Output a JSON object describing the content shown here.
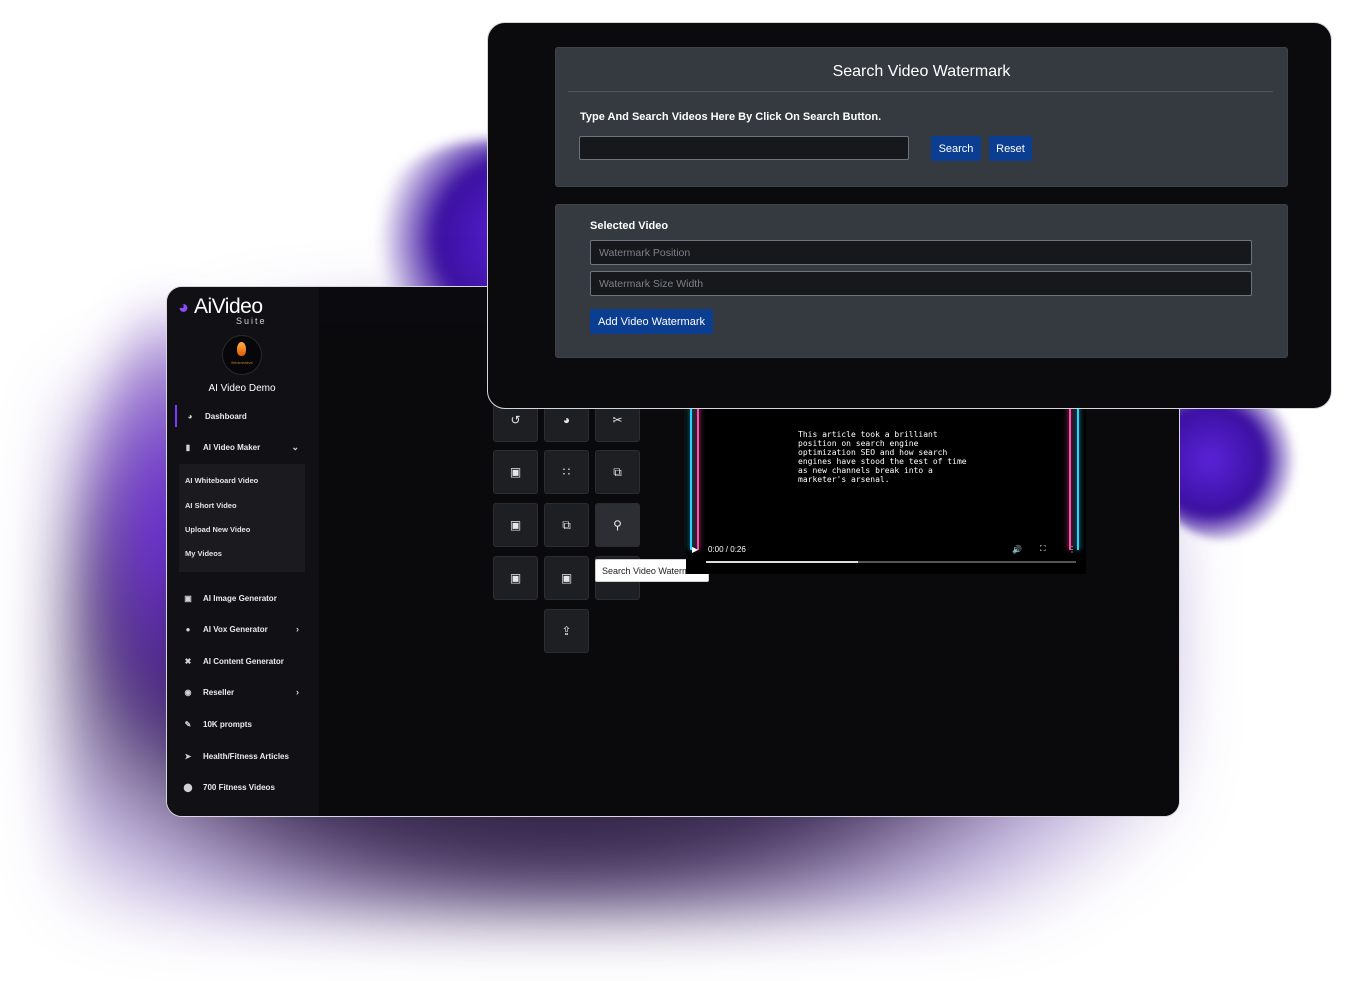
{
  "brand": {
    "logo_text": "AiVideo",
    "logo_sub": "Suite",
    "avatar_text": "fieldcreative"
  },
  "user": {
    "name": "AI Video Demo"
  },
  "sidebar": {
    "items": [
      {
        "label": "Dashboard",
        "icon": "dashboard-icon"
      },
      {
        "label": "AI Video Maker",
        "icon": "video-camera-icon"
      },
      {
        "label": "AI Image Generator",
        "icon": "images-icon"
      },
      {
        "label": "AI Vox Generator",
        "icon": "microphone-icon"
      },
      {
        "label": "AI Content Generator",
        "icon": "tools-icon"
      },
      {
        "label": "Reseller",
        "icon": "users-icon"
      },
      {
        "label": "10K prompts",
        "icon": "pen-icon"
      },
      {
        "label": "Health/Fitness Articles",
        "icon": "paper-plane-icon"
      },
      {
        "label": "700 Fitness Videos",
        "icon": "circle-icon"
      }
    ],
    "submenu": [
      "AI Whiteboard Video",
      "AI Short Video",
      "Upload New Video",
      "My Videos"
    ]
  },
  "tools": {
    "tooltip": "Search Video Watermark",
    "icons": [
      "undo-icon",
      "speed-icon",
      "cut-icon",
      "image-icon",
      "grid-icon",
      "images-icon",
      "image-icon",
      "images-icon",
      "search-file-icon",
      "image-icon",
      "video-icon",
      "",
      "upload-icon"
    ]
  },
  "video": {
    "caption": "This article took a brilliant position on search engine optimization SEO and how search engines have stood the test of time as new channels break into a marketer's arsenal.",
    "time": "0:00 / 0:26",
    "progress": 0.41
  },
  "watermark_panel": {
    "title": "Search Video Watermark",
    "instruction": "Type And Search Videos Here By Click On Search Button.",
    "search_value": "",
    "search_button": "Search",
    "reset_button": "Reset",
    "selected_label": "Selected Video",
    "position_placeholder": "Watermark Position",
    "size_placeholder": "Watermark Size Width",
    "add_button": "Add Video Watermark"
  },
  "colors": {
    "accent": "#7b3cff",
    "button": "#0b3d91",
    "card": "#343a40",
    "background": "#0b0b0e"
  }
}
